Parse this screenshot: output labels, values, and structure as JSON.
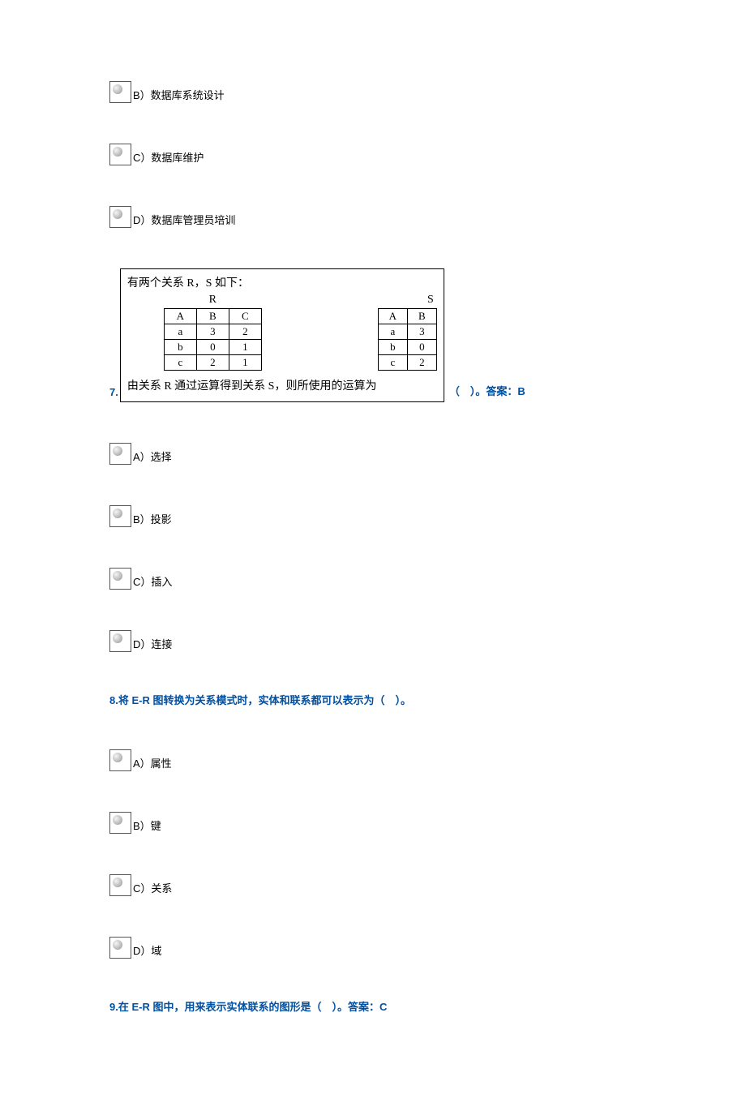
{
  "q6_options": {
    "b": "B）数据库系统设计",
    "c": "C）数据库维护",
    "d": "D）数据库管理员培训"
  },
  "q7": {
    "number": "7.",
    "prompt_top": "有两个关系 R，S 如下：",
    "label_R": "R",
    "label_S": "S",
    "table_R": {
      "header": [
        "A",
        "B",
        "C"
      ],
      "rows": [
        [
          "a",
          "3",
          "2"
        ],
        [
          "b",
          "0",
          "1"
        ],
        [
          "c",
          "2",
          "1"
        ]
      ]
    },
    "table_S": {
      "header": [
        "A",
        "B"
      ],
      "rows": [
        [
          "a",
          "3"
        ],
        [
          "b",
          "0"
        ],
        [
          "c",
          "2"
        ]
      ]
    },
    "prompt_bottom": "由关系 R 通过运算得到关系 S，则所使用的运算为",
    "tail": "（　）。答案：B",
    "options": {
      "a": "A）选择",
      "b": "B）投影",
      "c": "C）插入",
      "d": "D）连接"
    }
  },
  "q8": {
    "text": "8.将 E-R 图转换为关系模式时，实体和联系都可以表示为（　）。",
    "options": {
      "a": "A）属性",
      "b": "B）键",
      "c": "C）关系",
      "d": "D）域"
    }
  },
  "q9": {
    "text": "9.在 E-R 图中，用来表示实体联系的图形是（　）。答案：C"
  }
}
